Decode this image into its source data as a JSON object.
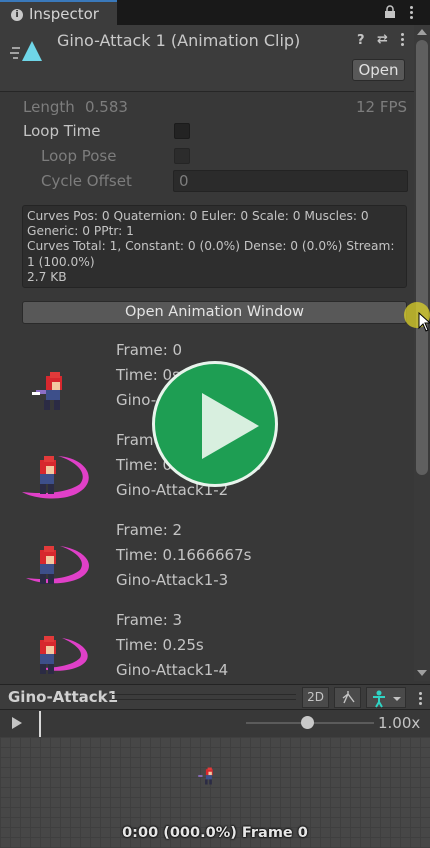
{
  "tab": {
    "label": "Inspector"
  },
  "header": {
    "title": "Gino-Attack 1 (Animation Clip)",
    "open_label": "Open",
    "help_glyph": "?",
    "settings_glyph": "⇄"
  },
  "properties": {
    "length_label": "Length",
    "length_value": "0.583",
    "fps": "12 FPS",
    "loop_time_label": "Loop Time",
    "loop_pose_label": "Loop Pose",
    "cycle_offset_label": "Cycle Offset",
    "cycle_offset_value": "0"
  },
  "info": {
    "line1": "Curves Pos: 0 Quaternion: 0 Euler: 0 Scale: 0 Muscles: 0",
    "line2": "Generic: 0 PPtr: 1",
    "line3": "Curves Total: 1, Constant: 0 (0.0%) Dense: 0 (0.0%) Stream:",
    "line4": "1 (100.0%)",
    "line5": "2.7 KB"
  },
  "open_animation_window_label": "Open Animation Window",
  "frames": [
    {
      "frame": "Frame: 0",
      "time": "Time: 0s",
      "name": "Gino-Attack1-1"
    },
    {
      "frame": "Frame: 1",
      "time": "Time: 0.08333334s",
      "name": "Gino-Attack1-2"
    },
    {
      "frame": "Frame: 2",
      "time": "Time: 0.1666667s",
      "name": "Gino-Attack1-3"
    },
    {
      "frame": "Frame: 3",
      "time": "Time: 0.25s",
      "name": "Gino-Attack1-4"
    }
  ],
  "preview": {
    "title": "Gino-Attack1",
    "btn_2d": "2D",
    "speed": "1.00x",
    "readout": "0:00 (000.0%) Frame 0"
  },
  "colors": {
    "accent": "#3a79bb",
    "clip_icon": "#6fd6e8",
    "play_overlay": "#1e9e53",
    "slash": "#e040c8"
  }
}
